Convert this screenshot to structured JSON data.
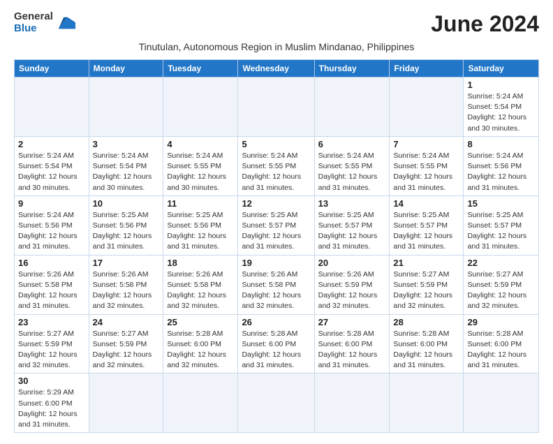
{
  "logo": {
    "text_general": "General",
    "text_blue": "Blue"
  },
  "header": {
    "month_year": "June 2024",
    "subtitle": "Tinutulan, Autonomous Region in Muslim Mindanao, Philippines"
  },
  "weekdays": [
    "Sunday",
    "Monday",
    "Tuesday",
    "Wednesday",
    "Thursday",
    "Friday",
    "Saturday"
  ],
  "weeks": [
    [
      {
        "day": "",
        "info": ""
      },
      {
        "day": "",
        "info": ""
      },
      {
        "day": "",
        "info": ""
      },
      {
        "day": "",
        "info": ""
      },
      {
        "day": "",
        "info": ""
      },
      {
        "day": "",
        "info": ""
      },
      {
        "day": "1",
        "info": "Sunrise: 5:24 AM\nSunset: 5:54 PM\nDaylight: 12 hours and 30 minutes."
      }
    ],
    [
      {
        "day": "2",
        "info": "Sunrise: 5:24 AM\nSunset: 5:54 PM\nDaylight: 12 hours and 30 minutes."
      },
      {
        "day": "3",
        "info": "Sunrise: 5:24 AM\nSunset: 5:54 PM\nDaylight: 12 hours and 30 minutes."
      },
      {
        "day": "4",
        "info": "Sunrise: 5:24 AM\nSunset: 5:55 PM\nDaylight: 12 hours and 30 minutes."
      },
      {
        "day": "5",
        "info": "Sunrise: 5:24 AM\nSunset: 5:55 PM\nDaylight: 12 hours and 31 minutes."
      },
      {
        "day": "6",
        "info": "Sunrise: 5:24 AM\nSunset: 5:55 PM\nDaylight: 12 hours and 31 minutes."
      },
      {
        "day": "7",
        "info": "Sunrise: 5:24 AM\nSunset: 5:55 PM\nDaylight: 12 hours and 31 minutes."
      },
      {
        "day": "8",
        "info": "Sunrise: 5:24 AM\nSunset: 5:56 PM\nDaylight: 12 hours and 31 minutes."
      }
    ],
    [
      {
        "day": "9",
        "info": "Sunrise: 5:24 AM\nSunset: 5:56 PM\nDaylight: 12 hours and 31 minutes."
      },
      {
        "day": "10",
        "info": "Sunrise: 5:25 AM\nSunset: 5:56 PM\nDaylight: 12 hours and 31 minutes."
      },
      {
        "day": "11",
        "info": "Sunrise: 5:25 AM\nSunset: 5:56 PM\nDaylight: 12 hours and 31 minutes."
      },
      {
        "day": "12",
        "info": "Sunrise: 5:25 AM\nSunset: 5:57 PM\nDaylight: 12 hours and 31 minutes."
      },
      {
        "day": "13",
        "info": "Sunrise: 5:25 AM\nSunset: 5:57 PM\nDaylight: 12 hours and 31 minutes."
      },
      {
        "day": "14",
        "info": "Sunrise: 5:25 AM\nSunset: 5:57 PM\nDaylight: 12 hours and 31 minutes."
      },
      {
        "day": "15",
        "info": "Sunrise: 5:25 AM\nSunset: 5:57 PM\nDaylight: 12 hours and 31 minutes."
      }
    ],
    [
      {
        "day": "16",
        "info": "Sunrise: 5:26 AM\nSunset: 5:58 PM\nDaylight: 12 hours and 31 minutes."
      },
      {
        "day": "17",
        "info": "Sunrise: 5:26 AM\nSunset: 5:58 PM\nDaylight: 12 hours and 32 minutes."
      },
      {
        "day": "18",
        "info": "Sunrise: 5:26 AM\nSunset: 5:58 PM\nDaylight: 12 hours and 32 minutes."
      },
      {
        "day": "19",
        "info": "Sunrise: 5:26 AM\nSunset: 5:58 PM\nDaylight: 12 hours and 32 minutes."
      },
      {
        "day": "20",
        "info": "Sunrise: 5:26 AM\nSunset: 5:59 PM\nDaylight: 12 hours and 32 minutes."
      },
      {
        "day": "21",
        "info": "Sunrise: 5:27 AM\nSunset: 5:59 PM\nDaylight: 12 hours and 32 minutes."
      },
      {
        "day": "22",
        "info": "Sunrise: 5:27 AM\nSunset: 5:59 PM\nDaylight: 12 hours and 32 minutes."
      }
    ],
    [
      {
        "day": "23",
        "info": "Sunrise: 5:27 AM\nSunset: 5:59 PM\nDaylight: 12 hours and 32 minutes."
      },
      {
        "day": "24",
        "info": "Sunrise: 5:27 AM\nSunset: 5:59 PM\nDaylight: 12 hours and 32 minutes."
      },
      {
        "day": "25",
        "info": "Sunrise: 5:28 AM\nSunset: 6:00 PM\nDaylight: 12 hours and 32 minutes."
      },
      {
        "day": "26",
        "info": "Sunrise: 5:28 AM\nSunset: 6:00 PM\nDaylight: 12 hours and 31 minutes."
      },
      {
        "day": "27",
        "info": "Sunrise: 5:28 AM\nSunset: 6:00 PM\nDaylight: 12 hours and 31 minutes."
      },
      {
        "day": "28",
        "info": "Sunrise: 5:28 AM\nSunset: 6:00 PM\nDaylight: 12 hours and 31 minutes."
      },
      {
        "day": "29",
        "info": "Sunrise: 5:28 AM\nSunset: 6:00 PM\nDaylight: 12 hours and 31 minutes."
      }
    ],
    [
      {
        "day": "30",
        "info": "Sunrise: 5:29 AM\nSunset: 6:00 PM\nDaylight: 12 hours and 31 minutes."
      },
      {
        "day": "",
        "info": ""
      },
      {
        "day": "",
        "info": ""
      },
      {
        "day": "",
        "info": ""
      },
      {
        "day": "",
        "info": ""
      },
      {
        "day": "",
        "info": ""
      },
      {
        "day": "",
        "info": ""
      }
    ]
  ]
}
